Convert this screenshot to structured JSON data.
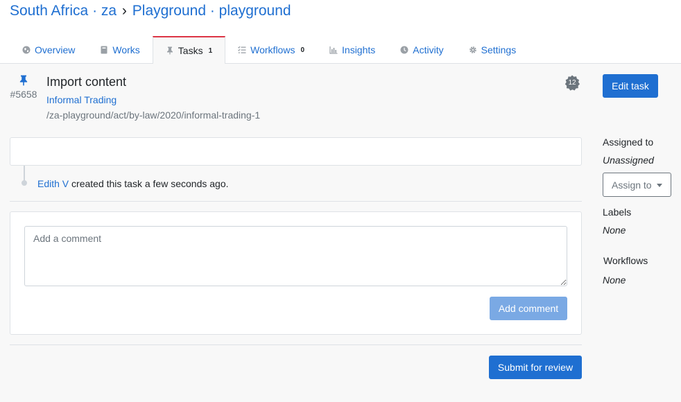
{
  "breadcrumb": {
    "country": "South Africa · za",
    "separator": "›",
    "place": "Playground · playground"
  },
  "tabs": [
    {
      "label": "Overview",
      "icon": "globe-icon"
    },
    {
      "label": "Works",
      "icon": "book-icon"
    },
    {
      "label": "Tasks",
      "icon": "pin-icon",
      "count": "1",
      "active": true
    },
    {
      "label": "Workflows",
      "icon": "tasks-list-icon",
      "count": "0"
    },
    {
      "label": "Insights",
      "icon": "chart-bar-icon"
    },
    {
      "label": "Activity",
      "icon": "clock-icon"
    },
    {
      "label": "Settings",
      "icon": "gear-icon"
    }
  ],
  "task": {
    "number": "#5658",
    "title": "Import content",
    "work_title": "Informal Trading",
    "frbr_uri": "/za-playground/act/by-law/2020/informal-trading-1",
    "badge_count": "12"
  },
  "timeline": {
    "user": "Edith V",
    "action": "created this task a few seconds ago."
  },
  "comment": {
    "placeholder": "Add a comment",
    "button_label": "Add comment"
  },
  "submit_label": "Submit for review",
  "sidebar": {
    "edit_label": "Edit task",
    "assigned_label": "Assigned to",
    "assigned_value": "Unassigned",
    "assign_button": "Assign to",
    "labels_label": "Labels",
    "labels_value": "None",
    "workflows_label": "Workflows",
    "workflows_value": "None"
  },
  "colors": {
    "primary": "#1f6fd1",
    "active_tab_accent": "#dc3545",
    "disabled_primary": "#7aa9e4"
  }
}
